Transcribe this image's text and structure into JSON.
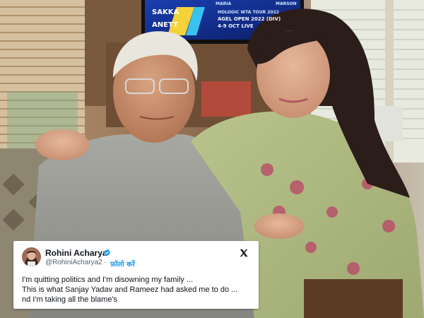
{
  "tv": {
    "line1": "HOLOGIC WTA TOUR 2022",
    "line2": "AGEL OPEN 2022 (DIV)",
    "line3": "4-9 OCT LIVE",
    "side1": "SAKKA",
    "side2": "ANETT",
    "top1": "MARIA",
    "top2": "MARSON"
  },
  "tweet": {
    "name": "Rohini Acharya",
    "handle": "@RohiniAcharya2",
    "separator": "·",
    "follow_label": "फ़ॉलो करें",
    "lines": [
      "I'm quitting politics and I'm disowning my family ...",
      "This is what Sanjay Yadav and Rameez had asked me to do ...",
      "nd I'm taking all the blame's"
    ]
  },
  "colors": {
    "verified": "#1d9bf0",
    "follow": "#1d9bf0",
    "text": "#0f1419",
    "muted": "#536471"
  },
  "icons": {
    "verified": "verified-badge-icon",
    "brand": "x-logo-icon"
  }
}
